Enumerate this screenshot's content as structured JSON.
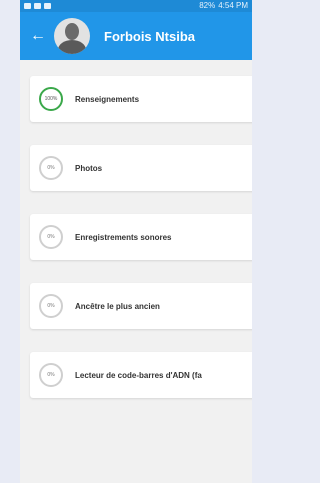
{
  "status_bar": {
    "left_icons": [
      "message-icon",
      "image-icon",
      "notification-icon"
    ],
    "right_text": "4:54 PM",
    "battery": "82%"
  },
  "app_bar": {
    "back_icon": "back-arrow-icon",
    "title": "Forbois Ntsiba"
  },
  "sections": [
    {
      "label": "Renseignements",
      "progress": "100%"
    },
    {
      "label": "Photos",
      "progress": "0%"
    },
    {
      "label": "Enregistrements sonores",
      "progress": "0%"
    },
    {
      "label": "Ancêtre le plus ancien",
      "progress": "0%"
    },
    {
      "label": "Lecteur de code-barres d'ADN (fa",
      "progress": "0%"
    }
  ],
  "colors": {
    "app_bar": "#2196e8",
    "status_bar": "#1e8ad6",
    "complete_ring": "#3aa84a",
    "incomplete_ring": "#cfcfcf"
  }
}
